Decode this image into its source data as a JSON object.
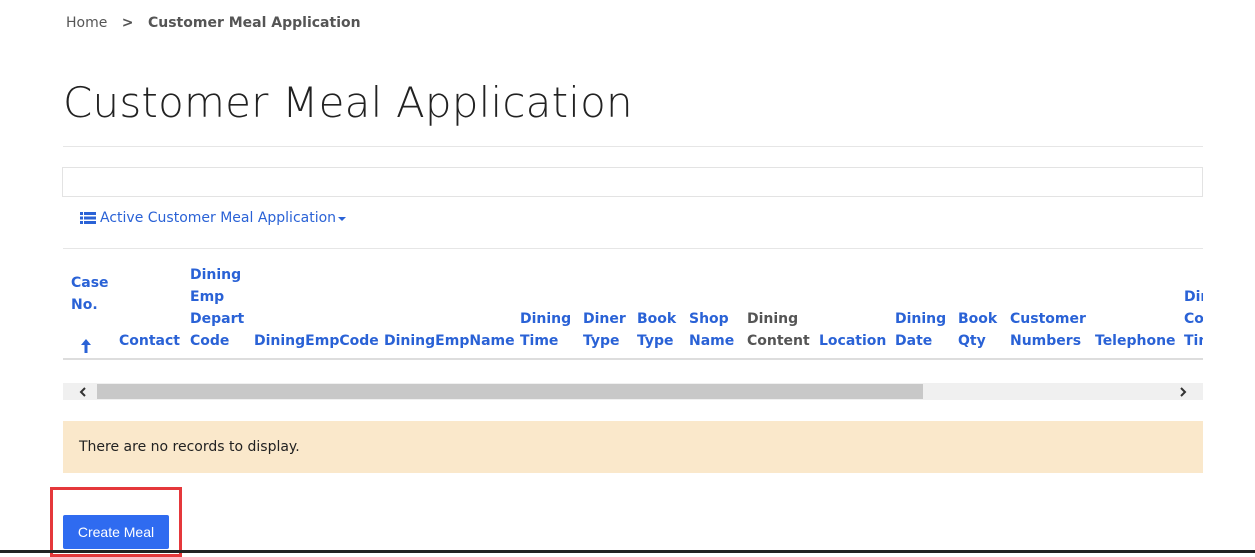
{
  "breadcrumb": {
    "home": "Home",
    "separator": ">",
    "current": "Customer Meal Application"
  },
  "page": {
    "title": "Customer Meal Application"
  },
  "view": {
    "label": "Active Customer Meal Application",
    "icon": "list-icon"
  },
  "table": {
    "columns": [
      {
        "label": "Case\nNo.",
        "sortable": true,
        "sorted": "asc"
      },
      {
        "label": "Contact",
        "sortable": true
      },
      {
        "label": "Dining\nEmp\nDepart\nCode",
        "sortable": true
      },
      {
        "label": "DiningEmpCode",
        "sortable": true
      },
      {
        "label": "DiningEmpName",
        "sortable": true
      },
      {
        "label": "Dining\nTime",
        "sortable": true
      },
      {
        "label": "Diner\nType",
        "sortable": true
      },
      {
        "label": "Book\nType",
        "sortable": true
      },
      {
        "label": "Shop\nName",
        "sortable": true
      },
      {
        "label": "Dining\nContent",
        "sortable": false
      },
      {
        "label": "Location",
        "sortable": true
      },
      {
        "label": "Dining\nDate",
        "sortable": true
      },
      {
        "label": "Book\nQty",
        "sortable": true
      },
      {
        "label": "Customer\nNumbers",
        "sortable": true
      },
      {
        "label": "Telephone",
        "sortable": true
      },
      {
        "label": "Dining\nConfirm\nTime",
        "sortable": true
      }
    ],
    "empty_message": "There are no records to display."
  },
  "actions": {
    "create_label": "Create Meal"
  },
  "colors": {
    "link": "#2a62d6",
    "button": "#2f6bf0",
    "empty_bg": "#fae8cb",
    "highlight": "#e5383b"
  }
}
